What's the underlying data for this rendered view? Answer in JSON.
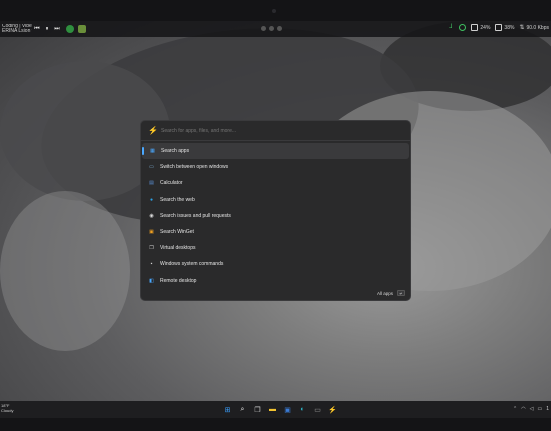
{
  "topbar": {
    "media_title": "Coding | Vibe",
    "media_subtitle": "ERINA Lsion ft...",
    "prev_icon": "skip-back-icon",
    "play_icon": "pause-icon",
    "next_icon": "skip-forward-icon",
    "stats": [
      {
        "icon": "network-icon",
        "value": ""
      },
      {
        "icon": "status-ok-icon",
        "value": ""
      },
      {
        "icon": "cpu-icon",
        "value": "24%"
      },
      {
        "icon": "memory-icon",
        "value": "38%"
      },
      {
        "icon": "network-speed-icon",
        "value": "90.0 Kbps"
      }
    ]
  },
  "palette": {
    "search_placeholder": "Search for apps, files, and more...",
    "items": [
      {
        "label": "Search apps",
        "icon": "apps-icon",
        "color": "#4aa8ff",
        "selected": true
      },
      {
        "label": "Switch between open windows",
        "icon": "windows-switch-icon",
        "color": "#7fb0d8",
        "selected": false
      },
      {
        "label": "Calculator",
        "icon": "calculator-icon",
        "color": "#5b8fd6",
        "selected": false
      },
      {
        "label": "Search the web",
        "icon": "web-icon",
        "color": "#2aa3e8",
        "selected": false
      },
      {
        "label": "Search issues and pull requests",
        "icon": "github-icon",
        "color": "#e0e0e0",
        "selected": false
      },
      {
        "label": "Search WinGet",
        "icon": "winget-icon",
        "color": "#f0a020",
        "selected": false
      },
      {
        "label": "Virtual desktops",
        "icon": "virtual-desktops-icon",
        "color": "#cfcfcf",
        "selected": false
      },
      {
        "label": "Windows system commands",
        "icon": "system-commands-icon",
        "color": "#cfcfcf",
        "selected": false
      },
      {
        "label": "Remote desktop",
        "icon": "remote-desktop-icon",
        "color": "#4aa8ff",
        "selected": false
      }
    ],
    "footer_label": "All apps"
  },
  "taskbar": {
    "left_line1": "18°F",
    "left_line2": "Cloudy",
    "apps": [
      {
        "icon": "windows-start-icon",
        "color": "#3aa0ff"
      },
      {
        "icon": "search-icon",
        "color": "#e6e6e6"
      },
      {
        "icon": "task-view-icon",
        "color": "#cfcfcf"
      },
      {
        "icon": "file-explorer-icon",
        "color": "#f2c330"
      },
      {
        "icon": "store-icon",
        "color": "#3a7bd5"
      },
      {
        "icon": "edge-icon",
        "color": "#2ab5c7"
      },
      {
        "icon": "terminal-icon",
        "color": "#9a9a9a"
      },
      {
        "icon": "powertoys-icon",
        "color": "#4aa8ff"
      }
    ],
    "tray_time": "1"
  }
}
